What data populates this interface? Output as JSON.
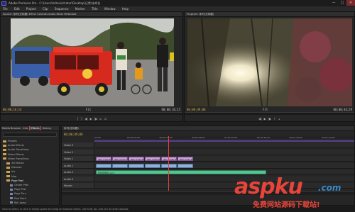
{
  "window": {
    "title": "Adobe Premiere Pro - C:\\Users\\Administrator\\Desktop\\日常\\未命名",
    "minimize": "—",
    "maximize": "□",
    "close": "✕"
  },
  "menu": [
    "File",
    "Edit",
    "Project",
    "Clip",
    "Sequence",
    "Marker",
    "Title",
    "Window",
    "Help"
  ],
  "source_monitor": {
    "tab": "Source: 序列(无标题)  Effect Controls  Audio Mixer  Metadata",
    "timecode_in": "00;00;16;14",
    "timecode_out": "00;00;16;15",
    "zoom": "Fit"
  },
  "program_monitor": {
    "tab": "Program: 序列(无标题)",
    "timecode_in": "00;00;49;08",
    "timecode_out": "00;00;44;29",
    "zoom": "Fit"
  },
  "project_panel": {
    "tabs": [
      "Media Browser",
      "Info",
      "Effects",
      "History"
    ],
    "active_tab": "Effects",
    "search_placeholder": "",
    "tree": [
      {
        "label": "Presets",
        "type": "folder",
        "indent": 0
      },
      {
        "label": "Audio Effects",
        "type": "folder",
        "indent": 0
      },
      {
        "label": "Audio Transitions",
        "type": "folder",
        "indent": 0
      },
      {
        "label": "Video Effects",
        "type": "folder",
        "indent": 0
      },
      {
        "label": "Video Transitions",
        "type": "folder",
        "indent": 0
      },
      {
        "label": "3D Motion",
        "type": "folder",
        "indent": 1
      },
      {
        "label": "Dissolve",
        "type": "folder",
        "indent": 1
      },
      {
        "label": "Iris",
        "type": "folder",
        "indent": 1
      },
      {
        "label": "Map",
        "type": "folder",
        "indent": 1
      },
      {
        "label": "Page Peel",
        "type": "folder",
        "indent": 1
      },
      {
        "label": "Center Peel",
        "type": "effect",
        "indent": 2
      },
      {
        "label": "Page Peel",
        "type": "effect",
        "indent": 2
      },
      {
        "label": "Page Turn",
        "type": "effect",
        "indent": 2
      },
      {
        "label": "Peel Back",
        "type": "effect",
        "indent": 2
      },
      {
        "label": "Roll Away",
        "type": "effect",
        "indent": 2
      },
      {
        "label": "Slide",
        "type": "folder",
        "indent": 1
      },
      {
        "label": "Special Effect",
        "type": "folder",
        "indent": 1
      }
    ]
  },
  "timeline": {
    "tab": "序列(无标题)",
    "timecode": "00;00;49;08",
    "ruler": [
      "00;00",
      "00;00;16;00",
      "00;00;32;00",
      "00;00;48;00",
      "00;01;04;02",
      "00;01;20;02",
      "00;01;36;02",
      "00;01;52;02"
    ],
    "tracks": [
      {
        "name": "Video 3",
        "kind": "video"
      },
      {
        "name": "Video 2",
        "kind": "video"
      },
      {
        "name": "Video 1",
        "kind": "video"
      },
      {
        "name": "Audio 1",
        "kind": "audio"
      },
      {
        "name": "Audio 2",
        "kind": "audio"
      },
      {
        "name": "Audio 3",
        "kind": "audio"
      },
      {
        "name": "Master",
        "kind": "audio"
      }
    ],
    "video_clips": [
      "IMG_0192.MOV",
      "IMG_0193.MOV",
      "IMG_0194.MOV",
      "IMG_0195.MOV",
      "IMG_0196.MOV",
      "IMG_0197.MOV"
    ],
    "audio_clip": "最炫民族风.mp3"
  },
  "status_bar": "Click to select, or click in empty space and drag to marquee select. Use Shift, Alt, and Ctrl for other options.",
  "watermark": {
    "brand": "aspku",
    "tld": ".com",
    "subtitle": "免费网站源码下载站!"
  },
  "colors": {
    "accent": "#e0b54a",
    "playhead": "#e8403a",
    "video_clip": "#c9a0d8",
    "audio_clip": "#58c391",
    "watermark": "#e8443a"
  }
}
